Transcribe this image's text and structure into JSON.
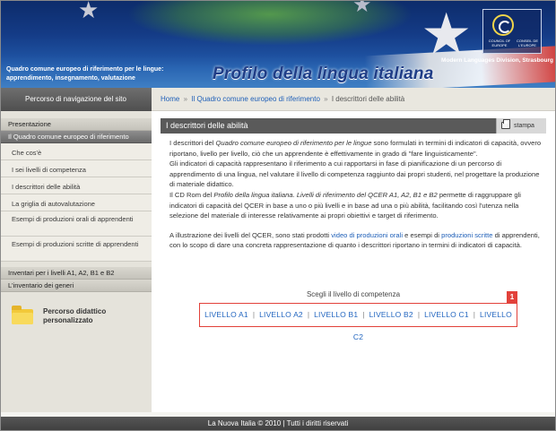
{
  "header": {
    "subtitle": "Quadro comune europeo di riferimento per le lingue: apprendimento, insegnamento, valutazione",
    "title": "Profilo della lingua italiana",
    "logo_left": "COUNCIL OF EUROPE",
    "logo_right": "CONSEIL DE L'EUROPE",
    "division": "Modern Languages Division, Strasbourg"
  },
  "nav": {
    "label": "Percorso di navigazione del sito",
    "breadcrumb": {
      "home": "Home",
      "sep": "»",
      "level1": "Il Quadro comune europeo di riferimento",
      "current": "I descrittori delle abilità"
    }
  },
  "sidebar": {
    "sections": [
      "Presentazione",
      "Il Quadro comune europeo di riferimento"
    ],
    "items": [
      "Che cos'è",
      "I sei livelli di competenza",
      "I descrittori delle abilità",
      "La griglia di autovalutazione",
      "Esempi di produzioni orali di apprendenti",
      "Esempi di produzioni scritte di apprendenti"
    ],
    "bottom_sections": [
      "Inventari per i livelli A1, A2, B1 e B2",
      "L'inventario dei generi"
    ],
    "extra": "Percorso didattico personalizzato"
  },
  "content": {
    "title": "I descrittori delle abilità",
    "print_label": "stampa",
    "p1_a": "I descrittori del ",
    "p1_em": "Quadro comune europeo di riferimento per le lingue",
    "p1_b": " sono formulati in termini di indicatori di capacità, ovvero riportano, livello per livello, ciò che un apprendente è effettivamente in grado di \"fare linguisticamente\".",
    "p1_c": "Gli indicatori di capacità rappresentano il riferimento a cui rapportarsi in fase di pianificazione di un percorso di apprendimento di una lingua, nel valutare il livello di competenza raggiunto dai propri studenti, nel progettare la produzione di materiale didattico.",
    "p1_d": "Il CD Rom del ",
    "p1_em2": "Profilo della lingua italiana. Livelli di riferimento del QCER A1, A2, B1 e B2",
    "p1_e": " permette di raggruppare gli indicatori di capacità del QCER in base a uno o più livelli e in base ad una o più abilità, facilitando così l'utenza nella selezione del materiale di interesse relativamente ai propri obiettivi e target di riferimento.",
    "p2_a": "A illustrazione dei livelli del QCER, sono stati prodotti ",
    "p2_link1": "video di produzioni orali",
    "p2_b": " e esempi di ",
    "p2_link2": "produzioni scritte",
    "p2_c": " di apprendenti, con lo scopo di dare una concreta rappresentazione di quanto i descrittori riportano in termini di indicatori di capacità.",
    "levels_title": "Scegli il livello di competenza",
    "levels": [
      "LIVELLO A1",
      "LIVELLO A2",
      "LIVELLO B1",
      "LIVELLO B2",
      "LIVELLO C1",
      "LIVELLO C2"
    ],
    "level_sep": "|",
    "badge": "1"
  },
  "footer": {
    "text": "La Nuova Italia © 2010 | Tutti i diritti riservati"
  },
  "icons": {
    "star": "★",
    "print": "printer-icon",
    "folder": "folder-icon"
  },
  "colors": {
    "link": "#2060b8",
    "highlight": "#e2413a",
    "header_blue": "#1f3d87"
  }
}
